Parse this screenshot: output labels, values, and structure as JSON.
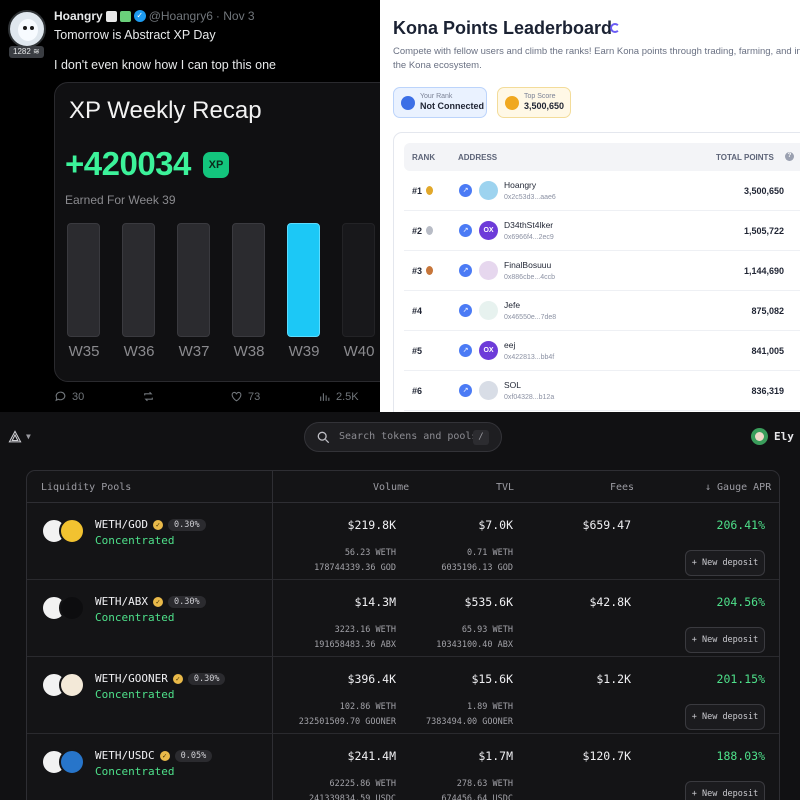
{
  "tweet": {
    "name": "Hoangry",
    "handle": "@Hoangry6",
    "date": "· Nov 3",
    "badge": "1282 ≋",
    "line1": "Tomorrow is Abstract XP Day",
    "line2": "I don't even know how I can top this one",
    "recap": {
      "title": "XP Weekly Recap",
      "amount": "+420034",
      "xp_badge": "XP",
      "subtitle": "Earned For Week 39",
      "weeks": [
        "W35",
        "W36",
        "W37",
        "W38",
        "W39",
        "W40"
      ],
      "active_week": "W39"
    },
    "actions": {
      "replies": "30",
      "reposts": "",
      "likes": "73",
      "views": "2.5K"
    },
    "colors": {
      "accent_green": "#3cf29a",
      "active_bar": "#1cc8f6"
    }
  },
  "kona": {
    "title": "Kona Points Leaderboard",
    "description": "Compete with fellow users and climb the ranks! Earn Kona points through trading, farming, and in the Kona ecosystem.",
    "your_rank_label": "Your Rank",
    "your_rank_value": "Not Connected",
    "top_score_label": "Top Score",
    "top_score_value": "3,500,650",
    "headers": {
      "rank": "RANK",
      "address": "ADDRESS",
      "total": "TOTAL POINTS"
    },
    "rows": [
      {
        "rank": "#1",
        "name": "Hoangry",
        "addr": "0x2c53d3...aae6",
        "points": "3,500,650",
        "avatar": ""
      },
      {
        "rank": "#2",
        "name": "D34thSt4lker",
        "addr": "0x6966f4...2ec9",
        "points": "1,505,722",
        "avatar": "OX"
      },
      {
        "rank": "#3",
        "name": "FinalBosuuu",
        "addr": "0x886cbe...4ccb",
        "points": "1,144,690",
        "avatar": ""
      },
      {
        "rank": "#4",
        "name": "Jefe",
        "addr": "0x46550e...7de8",
        "points": "875,082",
        "avatar": ""
      },
      {
        "rank": "#5",
        "name": "eej",
        "addr": "0x422813...bb4f",
        "points": "841,005",
        "avatar": "OX"
      },
      {
        "rank": "#6",
        "name": "SOL",
        "addr": "0xf04328...b12a",
        "points": "836,319",
        "avatar": ""
      }
    ]
  },
  "pools": {
    "search_placeholder": "Search tokens and pools",
    "search_shortcut": "/",
    "user": "Ely",
    "headers": {
      "pools": "Liquidity Pools",
      "volume": "Volume",
      "tvl": "TVL",
      "fees": "Fees",
      "apr": "↓ Gauge APR"
    },
    "deposit_label": "+ New deposit",
    "rows": [
      {
        "pair": "WETH/GOD",
        "fee": "0.30%",
        "type": "Concentrated",
        "volume": "$219.8K",
        "tvl": "$7.0K",
        "fees": "$659.47",
        "apr": "206.41%",
        "vol_a": "56.23 WETH",
        "vol_b": "178744339.36 GOD",
        "tvl_a": "0.71 WETH",
        "tvl_b": "6035196.13 GOD",
        "token_color": "#f2c230"
      },
      {
        "pair": "WETH/ABX",
        "fee": "0.30%",
        "type": "Concentrated",
        "volume": "$14.3M",
        "tvl": "$535.6K",
        "fees": "$42.8K",
        "apr": "204.56%",
        "vol_a": "3223.16 WETH",
        "vol_b": "191658483.36 ABX",
        "tvl_a": "65.93 WETH",
        "tvl_b": "10343100.40 ABX",
        "token_color": "#0d0d0f"
      },
      {
        "pair": "WETH/GOONER",
        "fee": "0.30%",
        "type": "Concentrated",
        "volume": "$396.4K",
        "tvl": "$15.6K",
        "fees": "$1.2K",
        "apr": "201.15%",
        "vol_a": "102.86 WETH",
        "vol_b": "232501509.70 GOONER",
        "tvl_a": "1.89 WETH",
        "tvl_b": "7383494.00 GOONER",
        "token_color": "#f3e9d8"
      },
      {
        "pair": "WETH/USDC",
        "fee": "0.05%",
        "type": "Concentrated",
        "volume": "$241.4M",
        "tvl": "$1.7M",
        "fees": "$120.7K",
        "apr": "188.03%",
        "vol_a": "62225.86 WETH",
        "vol_b": "241339834.59 USDC",
        "tvl_a": "278.63 WETH",
        "tvl_b": "674456.64 USDC",
        "token_color": "#2775ca"
      }
    ]
  }
}
